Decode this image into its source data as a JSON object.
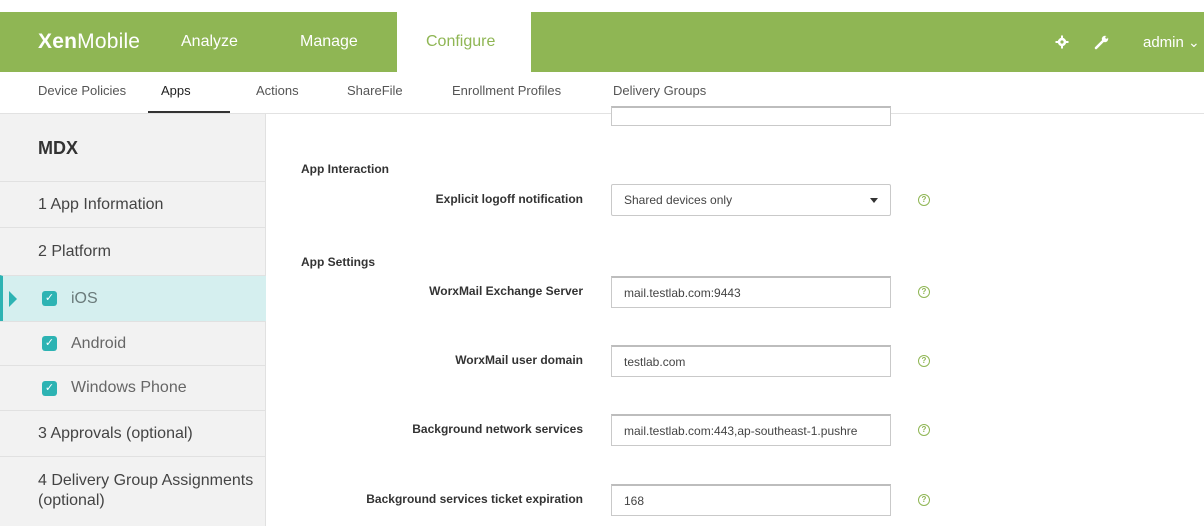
{
  "header": {
    "logo_bold": "Xen",
    "logo_light": "Mobile",
    "nav": {
      "analyze": "Analyze",
      "manage": "Manage",
      "configure": "Configure"
    },
    "settings_icon": "gear-icon",
    "tools_icon": "wrench-icon",
    "user": "admin",
    "user_caret": "⌄",
    "brand_color": "#8fb654"
  },
  "subnav": {
    "device_policies": "Device Policies",
    "apps": "Apps",
    "actions": "Actions",
    "sharefile": "ShareFile",
    "enrollment_profiles": "Enrollment Profiles",
    "delivery_groups": "Delivery Groups"
  },
  "sidebar": {
    "title": "MDX",
    "app_information": "1 App Information",
    "platform": "2 Platform",
    "ios": "iOS",
    "android": "Android",
    "windows_phone": "Windows Phone",
    "approvals": "3 Approvals (optional)",
    "delivery_group_line1": "4 Delivery Group Assignments",
    "delivery_group_line2": "(optional)",
    "accent_color": "#2db3b3"
  },
  "main": {
    "app_interaction_heading": "App Interaction",
    "explicit_logoff_label": "Explicit logoff notification",
    "explicit_logoff_value": "Shared devices only",
    "app_settings_heading": "App Settings",
    "exchange_server_label": "WorxMail Exchange Server",
    "exchange_server_value": "mail.testlab.com:9443",
    "user_domain_label": "WorxMail user domain",
    "user_domain_value": "testlab.com",
    "bg_network_label": "Background network services",
    "bg_network_value": "mail.testlab.com:443,ap-southeast-1.pushre",
    "bg_ticket_label": "Background services ticket expiration",
    "bg_ticket_value": "168",
    "help_glyph": "?"
  }
}
